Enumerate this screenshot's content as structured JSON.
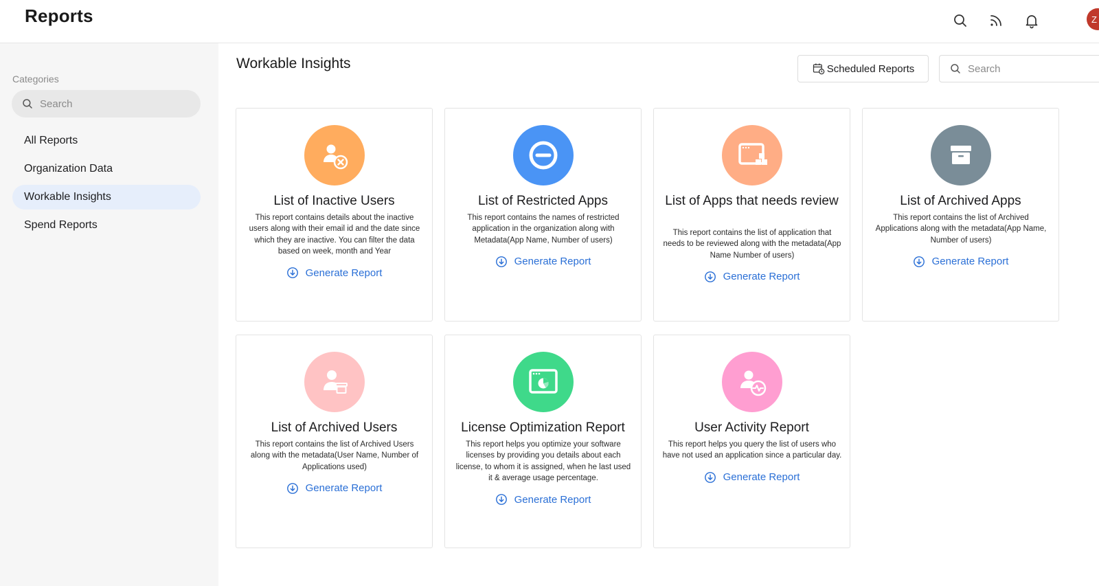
{
  "header": {
    "title": "Reports",
    "icons": [
      "search-icon",
      "rss-icon",
      "bell-icon"
    ],
    "avatar_initial": "Z"
  },
  "sidebar": {
    "categories_label": "Categories",
    "search_placeholder": "Search",
    "items": [
      {
        "label": "All Reports",
        "active": false
      },
      {
        "label": "Organization Data",
        "active": false
      },
      {
        "label": "Workable Insights",
        "active": true
      },
      {
        "label": "Spend Reports",
        "active": false
      }
    ]
  },
  "main": {
    "title": "Workable Insights",
    "scheduled_label": "Scheduled Reports",
    "search_placeholder": "Search",
    "generate_label": "Generate Report",
    "cards": [
      {
        "title": "List of Inactive Users",
        "description": "This report contains details about the inactive users along with their email id and the date since which they are inactive. You can filter the data based on week, month and Year",
        "icon": "user-remove-icon",
        "color": "#ffac5e"
      },
      {
        "title": "List of Restricted Apps",
        "description": "This report contains the names of restricted application in the organization along with Metadata(App Name, Number of users)",
        "icon": "minus-circle-icon",
        "color": "#4a94f5"
      },
      {
        "title": "List of Apps that needs review",
        "description": "This report contains the list of application that needs to be reviewed along with the metadata(App Name Number of users)",
        "icon": "app-review-icon",
        "color": "#ffad85"
      },
      {
        "title": "List of Archived Apps",
        "description": "This report contains the list of Archived Applications along with the metadata(App Name, Number of users)",
        "icon": "archive-box-icon",
        "color": "#7a8d98"
      },
      {
        "title": "List of Archived Users",
        "description": "This report contains the list of Archived Users along with the metadata(User Name, Number of Applications used)",
        "icon": "archived-user-icon",
        "color": "#ffc3c4"
      },
      {
        "title": "License Optimization Report",
        "description": "This report helps you optimize your software licenses by providing you details about each license, to whom it is assigned, when he last used it & average usage percentage.",
        "icon": "pie-window-icon",
        "color": "#3fd98a"
      },
      {
        "title": "User Activity Report",
        "description": "This report helps you query the list of users who have not used an application since a particular day.",
        "icon": "user-activity-icon",
        "color": "#ff9ed1"
      }
    ]
  },
  "colors": {
    "link": "#2a6fd6",
    "active_nav": "#e6eefb",
    "sidebar_bg": "#f6f6f6"
  }
}
